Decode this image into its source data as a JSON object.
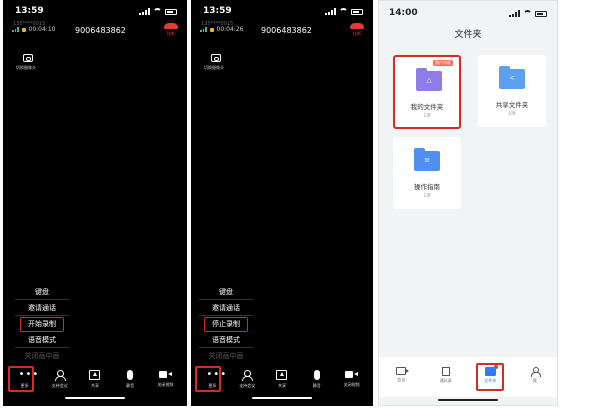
{
  "call_screen_1": {
    "status_time": "13:59",
    "subnumber": "135****0015",
    "duration": "00:04:10",
    "phone_number": "9006483862",
    "hangup_label": "挂断",
    "camera_label": "切换摄像头",
    "menu": [
      "键盘",
      "邀请通话",
      "开始录制",
      "语音模式",
      "关闭画中画"
    ],
    "tabs": [
      "更多",
      "支持会议",
      "共享",
      "静音",
      "关闭视频"
    ]
  },
  "call_screen_2": {
    "status_time": "13:59",
    "subnumber": "135****0015",
    "duration": "00:04:26",
    "phone_number": "9006483862",
    "hangup_label": "挂断",
    "camera_label": "切换摄像头",
    "menu": [
      "键盘",
      "邀请通话",
      "停止录制",
      "语音模式",
      "关闭画中画"
    ],
    "tabs": [
      "更多",
      "支持会议",
      "共享",
      "静音",
      "关闭视频"
    ]
  },
  "folders_screen": {
    "status_time": "14:00",
    "title": "文件夹",
    "cards": [
      {
        "name": "我的文件夹",
        "count": "1项",
        "badge": "图片内容"
      },
      {
        "name": "共享文件夹",
        "count": "0项"
      },
      {
        "name": "操作指南",
        "count": "1项"
      }
    ],
    "tabs": [
      "会议",
      "通讯录",
      "文件夹",
      "我"
    ]
  },
  "colors": {
    "highlight_red": "#d62c20",
    "accent_blue": "#2f7cf6",
    "my_folder_purple": "#8f7ce8"
  }
}
